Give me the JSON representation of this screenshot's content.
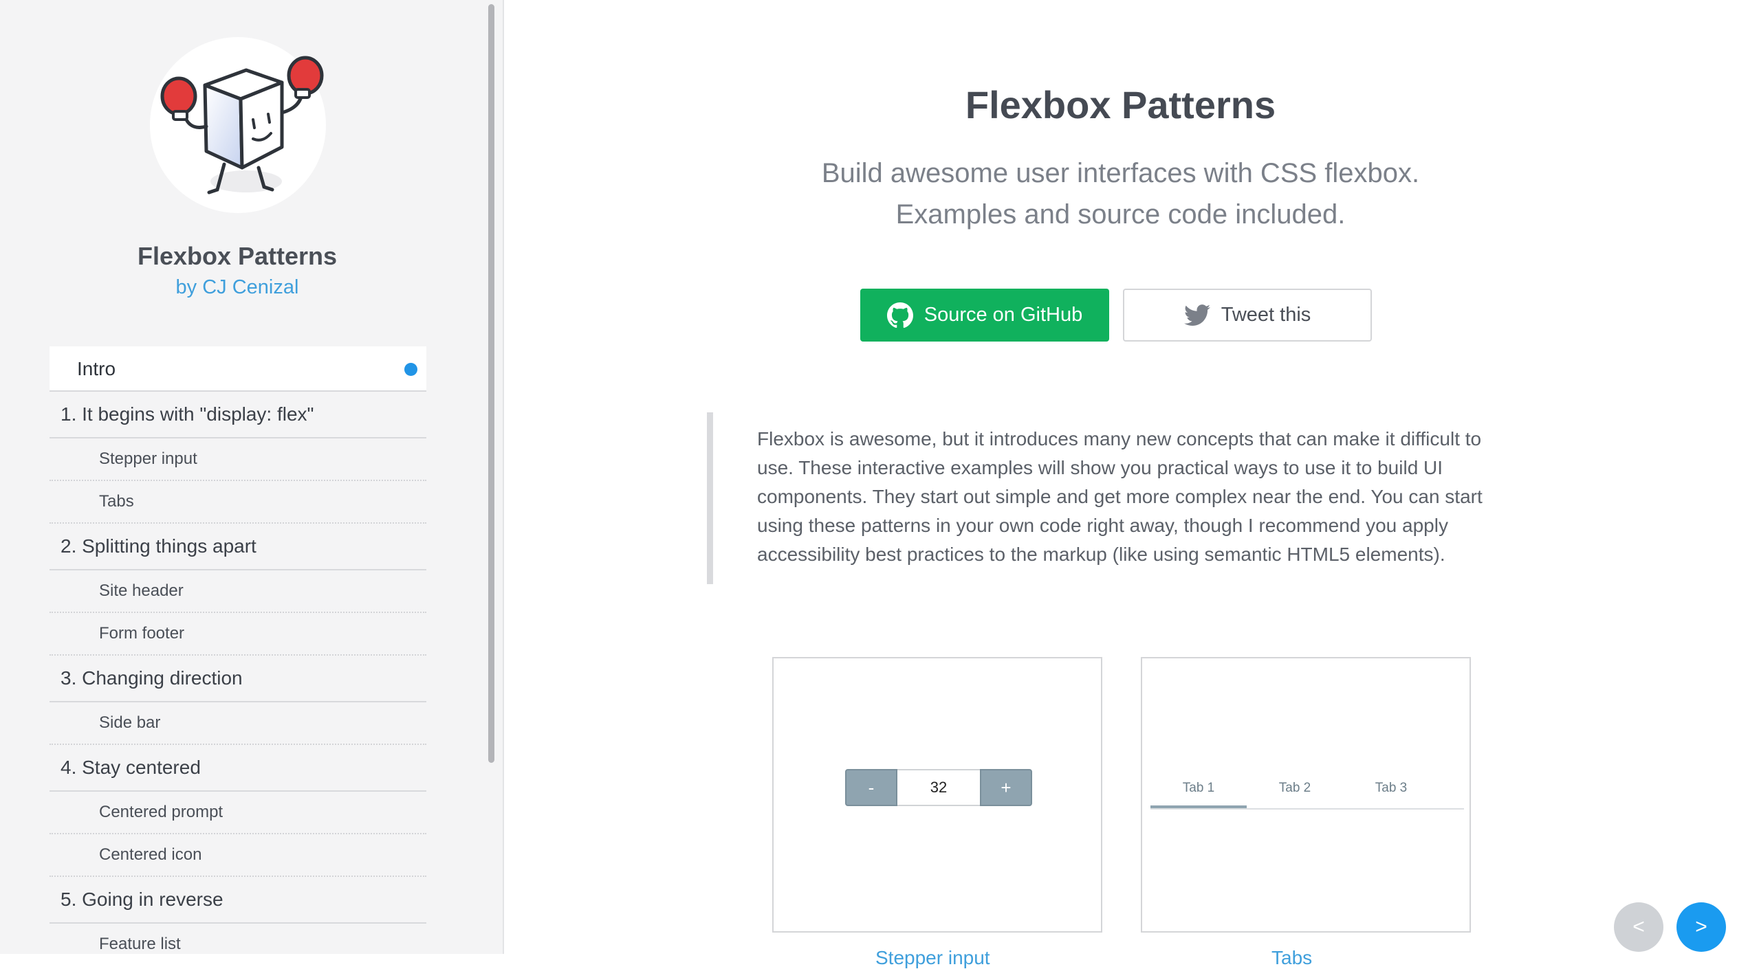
{
  "sidebar": {
    "title": "Flexbox Patterns",
    "author": "by CJ Cenizal",
    "items": [
      {
        "label": "Intro",
        "kind": "active"
      },
      {
        "label": "1. It begins with \"display: flex\"",
        "kind": "section"
      },
      {
        "label": "Stepper input",
        "kind": "sub"
      },
      {
        "label": "Tabs",
        "kind": "sub"
      },
      {
        "label": "2. Splitting things apart",
        "kind": "section"
      },
      {
        "label": "Site header",
        "kind": "sub"
      },
      {
        "label": "Form footer",
        "kind": "sub"
      },
      {
        "label": "3. Changing direction",
        "kind": "section"
      },
      {
        "label": "Side bar",
        "kind": "sub"
      },
      {
        "label": "4. Stay centered",
        "kind": "section"
      },
      {
        "label": "Centered prompt",
        "kind": "sub"
      },
      {
        "label": "Centered icon",
        "kind": "sub"
      },
      {
        "label": "5. Going in reverse",
        "kind": "section"
      },
      {
        "label": "Feature list",
        "kind": "sub"
      }
    ]
  },
  "hero": {
    "title": "Flexbox Patterns",
    "subtitle_line1": "Build awesome user interfaces with CSS flexbox.",
    "subtitle_line2": "Examples and source code included.",
    "github_label": "Source on GitHub",
    "tweet_label": "Tweet this"
  },
  "intro": {
    "text": "Flexbox is awesome, but it introduces many new concepts that can make it difficult to use. These interactive examples will show you practical ways to use it to build UI components. They start out simple and get more complex near the end. You can start using these patterns in your own code right away, though I recommend you apply accessibility best practices to the markup (like using semantic HTML5 elements)."
  },
  "examples": {
    "stepper": {
      "minus": "-",
      "value": "32",
      "plus": "+"
    },
    "tabs": [
      "Tab 1",
      "Tab 2",
      "Tab 3"
    ],
    "captions": [
      "Stepper input",
      "Tabs"
    ]
  },
  "pager": {
    "prev": "<",
    "next": ">"
  },
  "colors": {
    "accent": "#1a9bf0",
    "github_green": "#10b15d",
    "author_link": "#3f9fdc"
  }
}
